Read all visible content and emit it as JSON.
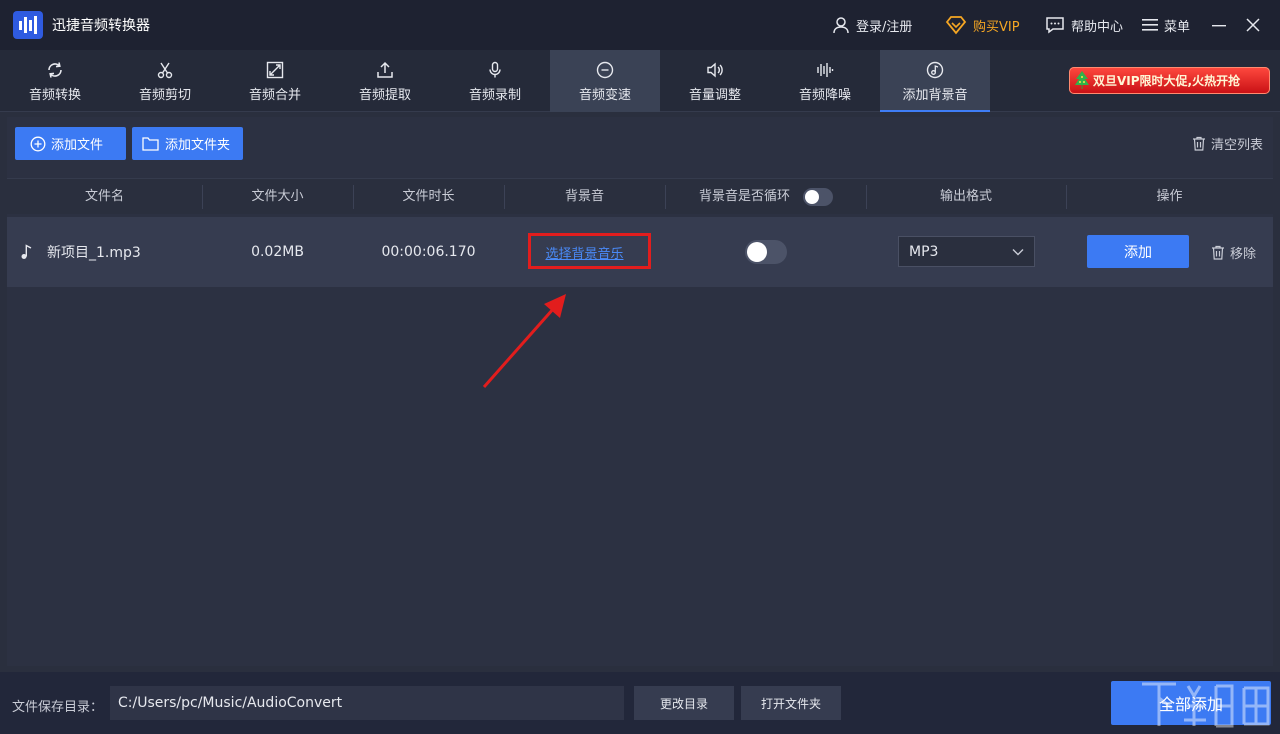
{
  "app": {
    "title": "迅捷音频转换器"
  },
  "titlebar": {
    "login": "登录/注册",
    "vip": "购买VIP",
    "help": "帮助中心",
    "menu": "菜单"
  },
  "tabs": [
    {
      "label": "音频转换",
      "icon": "refresh-icon"
    },
    {
      "label": "音频剪切",
      "icon": "scissors-icon"
    },
    {
      "label": "音频合并",
      "icon": "merge-icon"
    },
    {
      "label": "音频提取",
      "icon": "upload-icon"
    },
    {
      "label": "音频录制",
      "icon": "microphone-icon"
    },
    {
      "label": "音频变速",
      "icon": "speed-icon"
    },
    {
      "label": "音量调整",
      "icon": "speaker-icon"
    },
    {
      "label": "音频降噪",
      "icon": "waveform-icon"
    },
    {
      "label": "添加背景音",
      "icon": "music-note-icon"
    }
  ],
  "promo": "双旦VIP限时大促,火热开抢",
  "toolbar": {
    "add_file": "添加文件",
    "add_folder": "添加文件夹",
    "clear_list": "清空列表"
  },
  "table": {
    "columns": [
      "文件名",
      "文件大小",
      "文件时长",
      "背景音",
      "背景音是否循环",
      "输出格式",
      "操作"
    ],
    "rows": [
      {
        "name": "新项目_1.mp3",
        "size": "0.02MB",
        "duration": "00:00:06.170",
        "bgm_link": "选择背景音乐",
        "loop": false,
        "format": "MP3",
        "add_label": "添加",
        "remove_label": "移除"
      }
    ]
  },
  "footer": {
    "save_dir_label": "文件保存目录：",
    "save_dir_value": "C:/Users/pc/Music/AudioConvert",
    "change_dir": "更改目录",
    "open_folder": "打开文件夹",
    "add_all": "全部添加"
  },
  "colors": {
    "accent": "#3c7af3",
    "vip": "#f5a623",
    "annotation": "#e21d1d"
  }
}
